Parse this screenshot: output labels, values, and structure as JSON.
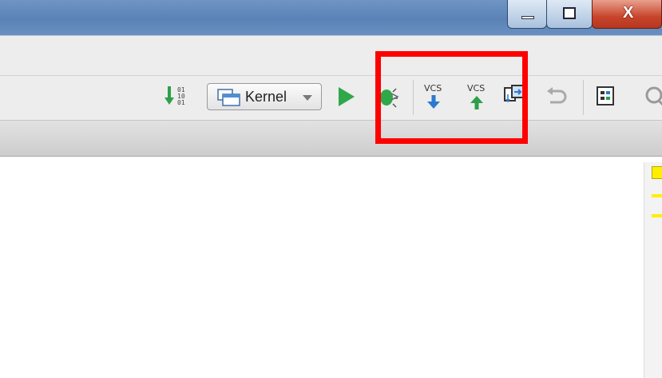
{
  "window": {
    "buttons": [
      {
        "name": "minimize",
        "icon": "minimize-icon"
      },
      {
        "name": "maximize",
        "icon": "maximize-icon"
      },
      {
        "name": "close",
        "icon": "close-icon",
        "label": "X"
      }
    ]
  },
  "toolbar": {
    "config_selector": {
      "value": "Kernel",
      "icon": "run-config-icon"
    },
    "items": [
      {
        "name": "binary-icon",
        "glyph_text": "01\n10\n01"
      },
      {
        "name": "run-icon"
      },
      {
        "name": "debug-icon"
      },
      {
        "name": "vcs-update-icon",
        "label": "VCS"
      },
      {
        "name": "vcs-commit-icon",
        "label": "VCS"
      },
      {
        "name": "vcs-compare-icon"
      },
      {
        "name": "undo-icon"
      },
      {
        "name": "structure-icon"
      },
      {
        "name": "search-icon"
      }
    ]
  },
  "colors": {
    "title_bar": "#5f87ba",
    "toolbar_bg": "#ededed",
    "highlight": "#ff0000",
    "run_green": "#2fa84a",
    "vcs_blue": "#2a7bd0",
    "vcs_green": "#2f9e4a",
    "marker_yellow": "#ffee00"
  }
}
